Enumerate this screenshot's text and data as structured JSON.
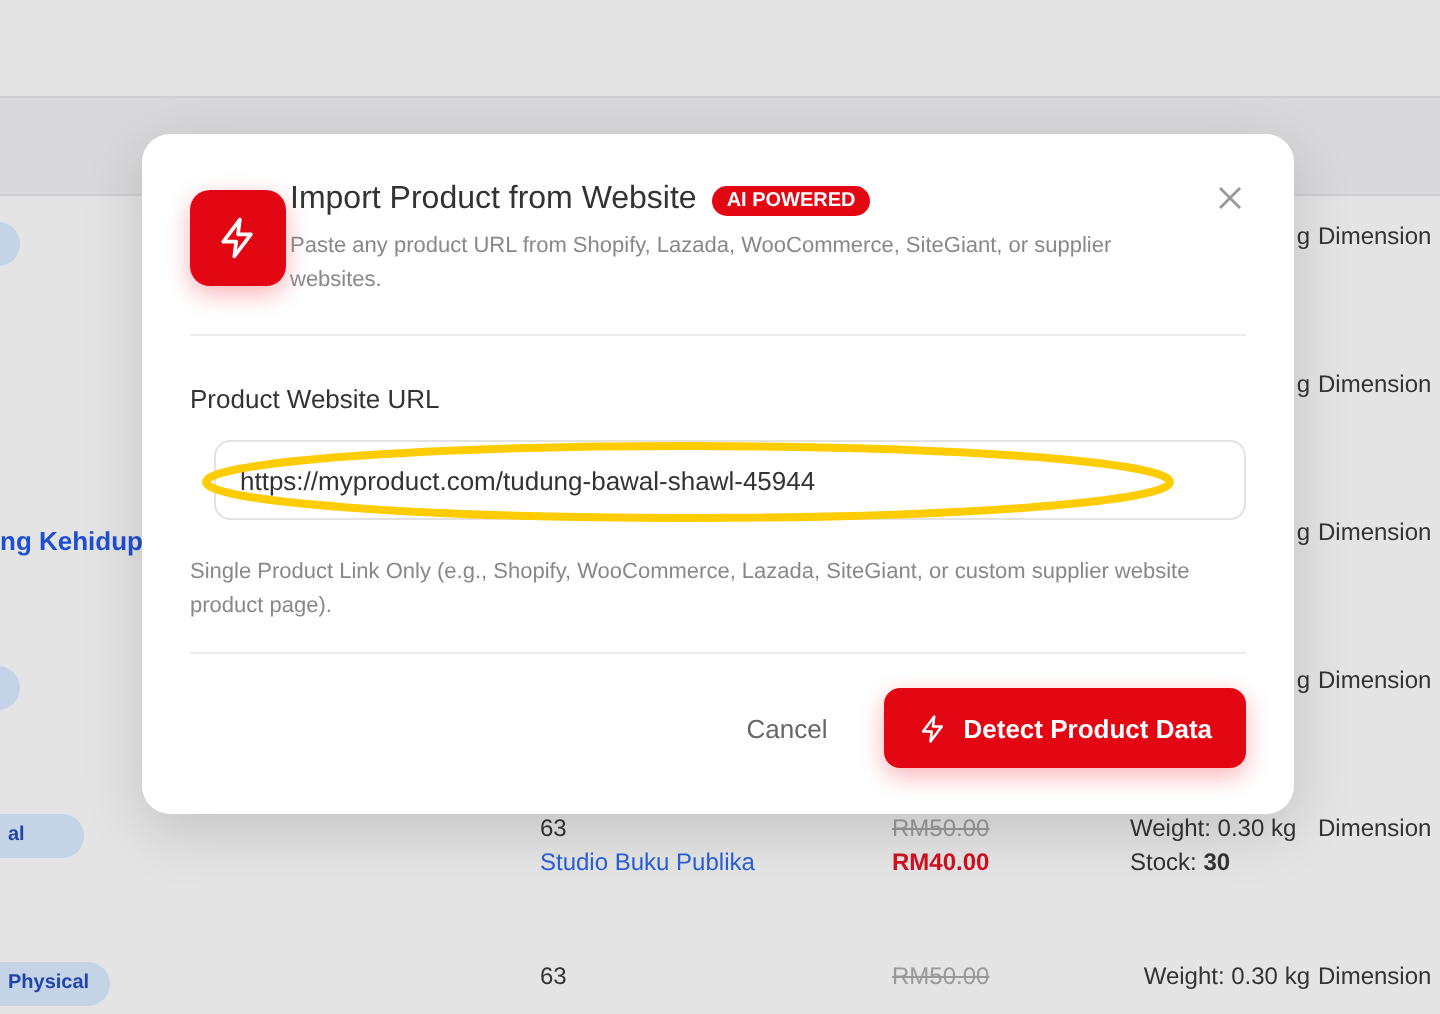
{
  "table": {
    "rows": [
      {
        "badge": "",
        "name": "",
        "account_id": "",
        "account_link": "",
        "old_price": "",
        "price": "",
        "weight": "g",
        "stock_label": "",
        "stock_value": "",
        "dimension": "Dimension"
      },
      {
        "name": "",
        "account_id": "",
        "account_link": "",
        "old_price": "",
        "price": "",
        "weight": "g",
        "stock_label": "",
        "stock_value": "",
        "dimension": "Dimension"
      },
      {
        "name": "ng Kehidup",
        "account_id": "",
        "account_link": "",
        "old_price": "",
        "price": "",
        "weight": "g",
        "stock_label": "",
        "stock_value": "",
        "dimension": "Dimension"
      },
      {
        "badge": "",
        "name": "",
        "account_id": "",
        "account_link": "",
        "old_price": "",
        "price": "",
        "weight": "g",
        "stock_label": "",
        "stock_value": "",
        "dimension": "Dimension"
      },
      {
        "badge": "al",
        "name": "",
        "account_id": "63",
        "account_link": "Studio Buku Publika",
        "old_price": "RM50.00",
        "price": "RM40.00",
        "weight": "Weight: 0.30 kg",
        "stock_label": "Stock:",
        "stock_value": "30",
        "dimension": "Dimension"
      },
      {
        "badge": "Physical",
        "name": "",
        "account_id": "63",
        "account_link": "",
        "old_price": "RM50.00",
        "price": "",
        "weight": "Weight: 0.30 kg",
        "stock_label": "",
        "stock_value": "",
        "dimension": "Dimension"
      }
    ]
  },
  "dialog": {
    "title": "Import Product from Website",
    "badge": "AI POWERED",
    "description": "Paste any product URL from Shopify, Lazada, WooCommerce, SiteGiant, or supplier websites.",
    "field_label": "Product Website URL",
    "field_value": "https://myproduct.com/tudung-bawal-shawl-45944",
    "helper": "Single Product Link Only (e.g., Shopify, WooCommerce, Lazada, SiteGiant, or custom supplier website product page).",
    "highlighted": true,
    "cancel": "Cancel",
    "submit": "Detect Product Data"
  }
}
